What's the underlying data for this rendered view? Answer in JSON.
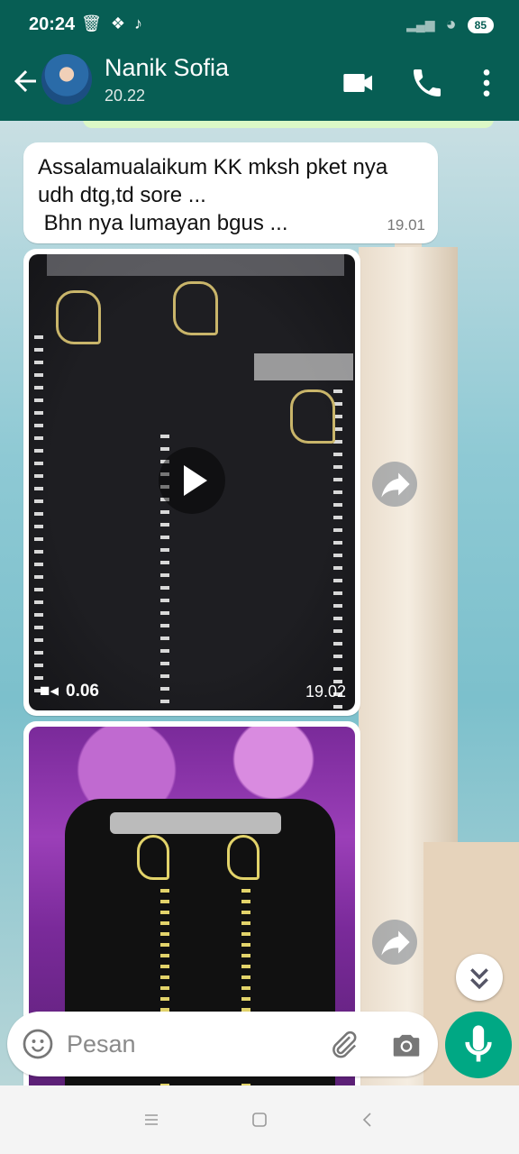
{
  "status_bar": {
    "time": "20:24",
    "icons": [
      "trash-icon",
      "dropbox-icon",
      "tiktok-icon"
    ],
    "battery": "85"
  },
  "header": {
    "contact_name": "Nanik Sofia",
    "last_seen": "20.22",
    "icons": [
      "back-arrow-icon",
      "video-call-icon",
      "phone-icon",
      "more-options-icon"
    ]
  },
  "messages": [
    {
      "type": "text",
      "text": "Assalamualaikum KK mksh pket nya\nudh dtg,td sore ...\n Bhn nya lumayan bgus ...",
      "time": "19.01"
    },
    {
      "type": "video",
      "duration": "0.06",
      "time": "19.02"
    },
    {
      "type": "image"
    }
  ],
  "input": {
    "placeholder": "Pesan"
  },
  "colors": {
    "header": "#075e54",
    "accent": "#00a884",
    "bubble": "#ffffff"
  }
}
